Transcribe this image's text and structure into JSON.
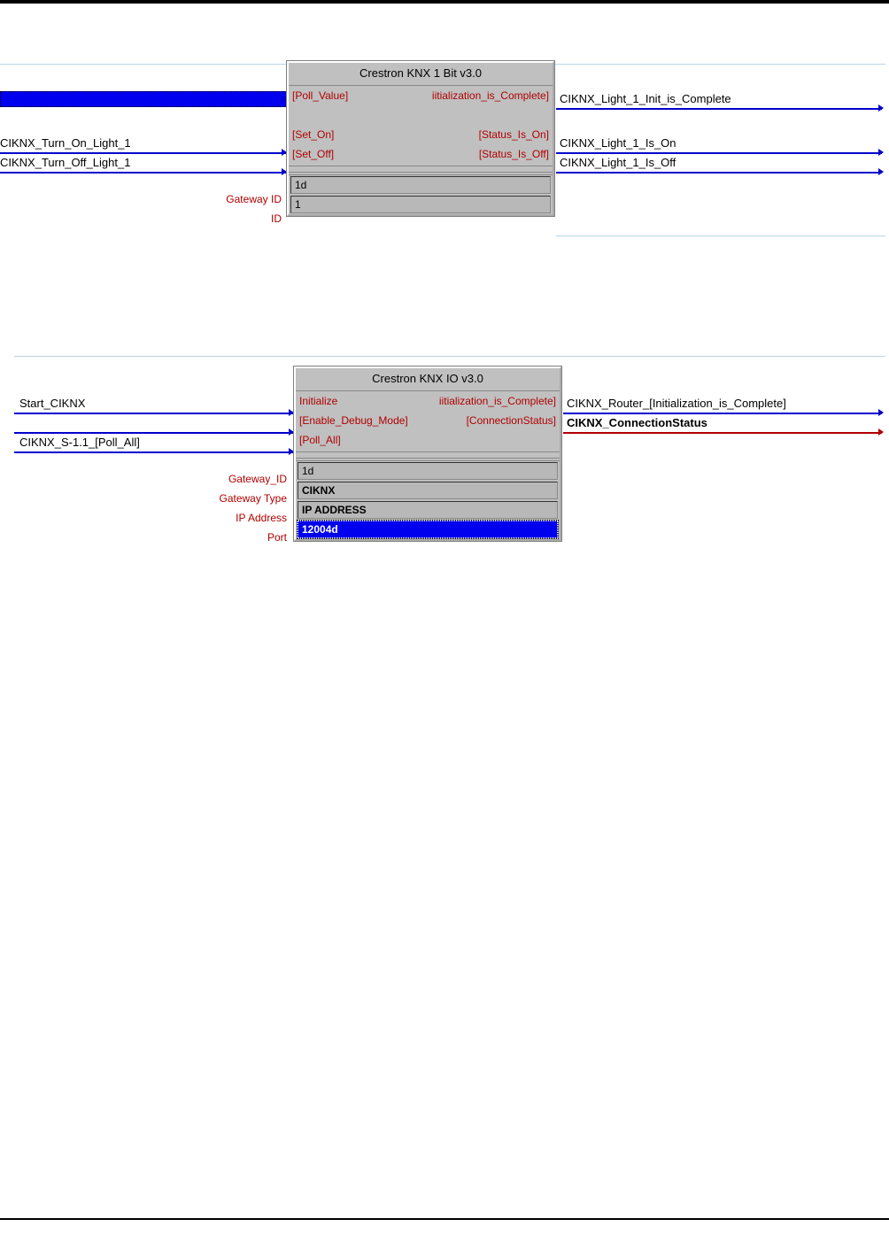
{
  "module1": {
    "title": "Crestron KNX 1 Bit v3.0",
    "inputs": {
      "poll": "[Poll_Value]",
      "seton": "[Set_On]",
      "setoff": "[Set_Off]"
    },
    "outputs": {
      "init": "iitialization_is_Complete]",
      "ison": "[Status_Is_On]",
      "isoff": "[Status_Is_Off]"
    },
    "params": {
      "gateway_label": "Gateway ID",
      "gateway_val": "1d",
      "id_label": "ID",
      "id_val": "1"
    },
    "signals_in": {
      "turnon": "CIKNX_Turn_On_Light_1",
      "turnoff": "CIKNX_Turn_Off_Light_1"
    },
    "signals_out": {
      "init": "CIKNX_Light_1_Init_is_Complete",
      "ison": "CIKNX_Light_1_Is_On",
      "isoff": "CIKNX_Light_1_Is_Off"
    }
  },
  "module2": {
    "title": "Crestron KNX IO v3.0",
    "inputs": {
      "init": "Initialize",
      "debug": "[Enable_Debug_Mode]",
      "poll": "[Poll_All]"
    },
    "outputs": {
      "initc": "iitialization_is_Complete]",
      "conn": "[ConnectionStatus]"
    },
    "params": {
      "gwid_label": "Gateway_ID",
      "gwid_val": "1d",
      "gwtype_label": "Gateway Type",
      "gwtype_val": "CIKNX",
      "ip_label": "IP Address",
      "ip_val": "IP ADDRESS",
      "port_label": "Port",
      "port_val": "12004d"
    },
    "signals_in": {
      "start": "Start_CIKNX",
      "poll": "CIKNX_S-1.1_[Poll_All]"
    },
    "signals_out": {
      "init": "CIKNX_Router_[Initialization_is_Complete]",
      "conn": "CIKNX_ConnectionStatus"
    }
  }
}
